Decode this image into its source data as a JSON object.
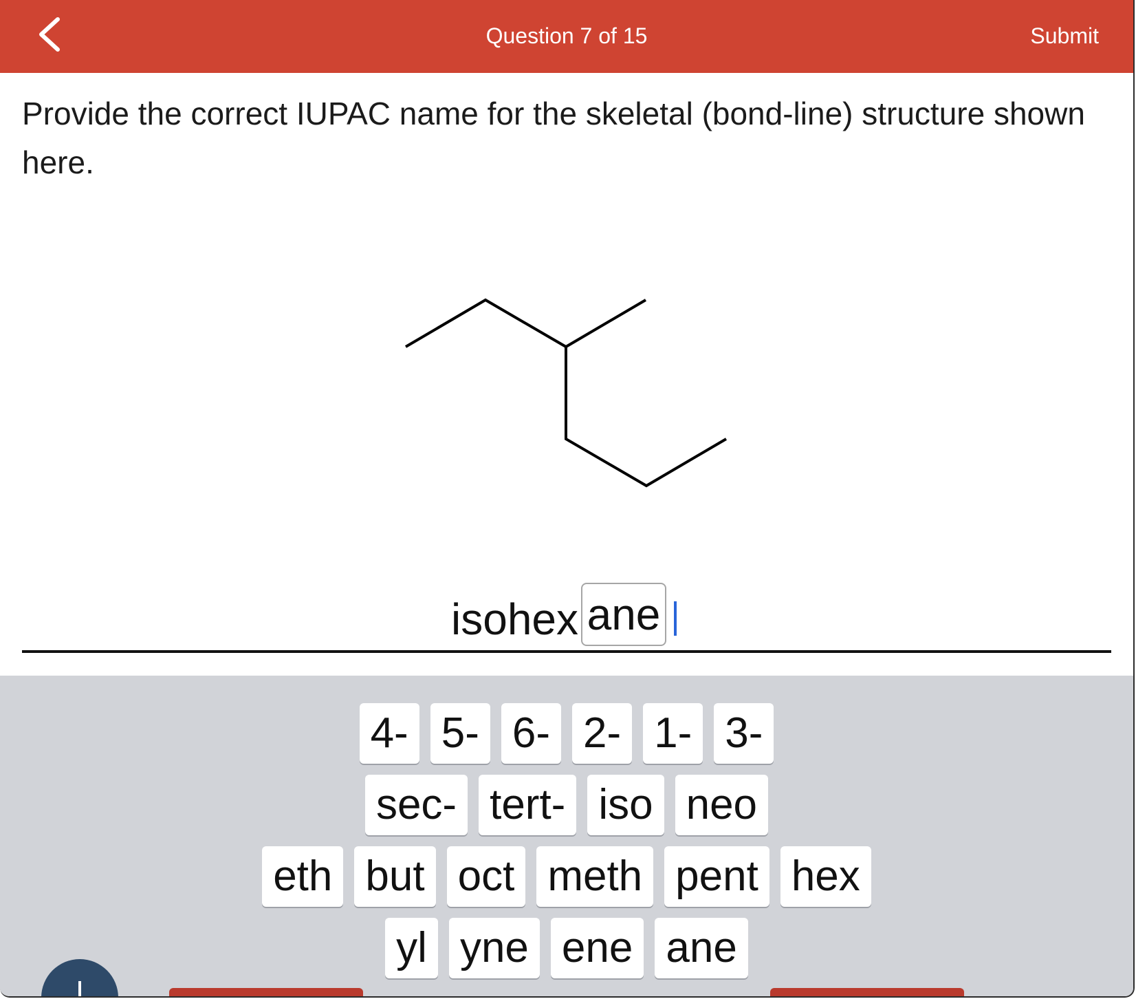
{
  "header": {
    "title": "Question 7 of 15",
    "submit_label": "Submit",
    "back_icon": "chevron-left-icon",
    "background_color": "#cf4432"
  },
  "prompt": {
    "text": "Provide the correct IUPAC name for the skeletal (bond-line) structure shown here."
  },
  "answer": {
    "prefix_text": "isohex",
    "selected_chip": "ane"
  },
  "keyboard": {
    "row1": [
      "4-",
      "5-",
      "6-",
      "2-",
      "1-",
      "3-"
    ],
    "row2": [
      "sec-",
      "tert-",
      "iso",
      "neo"
    ],
    "row3": [
      "eth",
      "but",
      "oct",
      "meth",
      "pent",
      "hex"
    ],
    "row4": [
      "yl",
      "yne",
      "ene",
      "ane"
    ]
  }
}
